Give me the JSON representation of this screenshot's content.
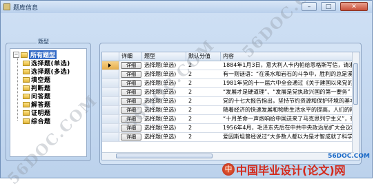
{
  "window": {
    "title": "题库信息"
  },
  "group": {
    "label": "题型"
  },
  "tree": {
    "root": "所有题型",
    "children": [
      "选择题(单选)",
      "选择题(多选)",
      "填空题",
      "判断题",
      "问答题",
      "解答题",
      "证明题",
      "综合题"
    ]
  },
  "grid": {
    "headers": [
      "详细",
      "题型",
      "默认分值",
      "内容"
    ],
    "rows": [
      {
        "button": "详细",
        "type": "选择题(单选)",
        "score": "2",
        "content": "1884年1月3日，意大利人卡内帕给恩格斯写信，请求他为"
      },
      {
        "button": "详细",
        "type": "选择题(单选)",
        "score": "2",
        "content": "有一则谜语：“在溪水和岩石的斗争中，胜利的总是溪水"
      },
      {
        "button": "详细",
        "type": "选择题(单选)",
        "score": "2",
        "content": "1981年党的十一届六中全会通过《关于建国以来党的若干"
      },
      {
        "button": "详细",
        "type": "选择题(单选)",
        "score": "2",
        "content": "“发展才是硬道理”、“发展是党执政兴国的第一要务”"
      },
      {
        "button": "详细",
        "type": "选择题(单选)",
        "score": "2",
        "content": "党的十七大报告指出，坚持节约资源和保护环境的基本国"
      },
      {
        "button": "详细",
        "type": "选择题(单选)",
        "score": "2",
        "content": "随着经济的快速发展和物质生活水平的提高，人们的精神"
      },
      {
        "button": "详细",
        "type": "选择题(单选)",
        "score": "2",
        "content": "“十月革命一声炮响给中国送来了马克思列宁主义”，在"
      },
      {
        "button": "详细",
        "type": "选择题(单选)",
        "score": "2",
        "content": "1956年4月，毛泽东先后在中共中央政治局扩大会议和"
      },
      {
        "button": "详细",
        "type": "选择题(单选)",
        "score": "2",
        "content": "爱因斯坦曾经说过“大多数人都以为是才智成就了科学家"
      }
    ]
  },
  "watermarks": [
    "56DOC.COM",
    "56DOC.COM",
    "56DOC.COM"
  ],
  "brand": {
    "logo_char": "中",
    "text": "中国毕业设计(论文)网",
    "url": "56DOC.COM"
  }
}
